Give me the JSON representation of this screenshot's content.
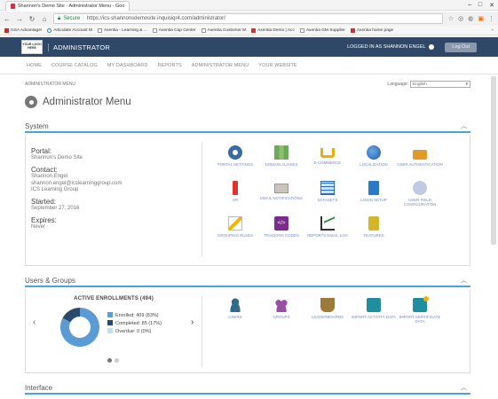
{
  "browser": {
    "window_title": "Shannon's Demo Site - Administrator Menu - Google Chrome",
    "secure_label": "Secure",
    "url": "https://ics-shannonsdemosite.inquisiqr4.com/administrator/",
    "bookmarks": [
      {
        "label": "GSA Advantage!",
        "icon": "red"
      },
      {
        "label": "Articulate Account M",
        "icon": "blue"
      },
      {
        "label": "Axentia - Learning & ...",
        "icon": "page"
      },
      {
        "label": "Axentia Cap Center",
        "icon": "page"
      },
      {
        "label": "Axentia Customer M",
        "icon": "page"
      },
      {
        "label": "Axentia Demo | Acc",
        "icon": "ax"
      },
      {
        "label": "Axentia GM Supplier",
        "icon": "page"
      },
      {
        "label": "Axentia home page",
        "icon": "ax"
      }
    ],
    "more": "»"
  },
  "header": {
    "logo_text": "YOUR LOGO HERE",
    "title": "ADMINISTRATOR",
    "logged_in": "LOGGED IN AS SHANNON ENGEL",
    "logout": "Log Out"
  },
  "menu": [
    "HOME",
    "COURSE CATALOG",
    "MY DASHBOARD",
    "REPORTS",
    "ADMINISTRATOR MENU",
    "YOUR WEBSITE"
  ],
  "page": {
    "breadcrumb": "ADMINISTRATOR MENU",
    "language_label": "Language:",
    "language_value": "English",
    "title": "Administrator Menu"
  },
  "system": {
    "heading": "System",
    "portal_label": "Portal:",
    "portal_value": "Shannon's Demo Site",
    "contact_label": "Contact:",
    "contact_name": "Shannon Engel",
    "contact_email": "shannon.engel@icslearninggroup.com",
    "contact_org": "ICS Learning Group",
    "started_label": "Started:",
    "started_value": "September 27, 2016",
    "expires_label": "Expires:",
    "expires_value": "Never",
    "tiles": [
      {
        "label": "PORTAL SETTINGS",
        "icon": "gear-icon",
        "cls": "ic-gear"
      },
      {
        "label": "DOMAIN ALIASES",
        "icon": "map-icon",
        "cls": "ic-map"
      },
      {
        "label": "E-COMMERCE",
        "icon": "cart-icon",
        "cls": "ic-cart"
      },
      {
        "label": "LOCALIZATION",
        "icon": "globe-icon",
        "cls": "ic-globe"
      },
      {
        "label": "USER AUTHENTICATION",
        "icon": "lock-icon",
        "cls": "ic-lock"
      },
      {
        "label": "API",
        "icon": "plug-icon",
        "cls": "ic-plug"
      },
      {
        "label": "EMAIL NOTIFICATIONS",
        "icon": "envelope-icon",
        "cls": "ic-env"
      },
      {
        "label": "DATASETS",
        "icon": "table-icon",
        "cls": "ic-table"
      },
      {
        "label": "LOGIN SETUP",
        "icon": "login-icon",
        "cls": "ic-login"
      },
      {
        "label": "USER FIELD CONFIGURATION",
        "icon": "user-gear-icon",
        "cls": "ic-ufield"
      },
      {
        "label": "GROUPING RULES",
        "icon": "bolt-icon",
        "cls": "ic-bolt"
      },
      {
        "label": "TRACKING CODES",
        "icon": "code-icon",
        "cls": "ic-code"
      },
      {
        "label": "REPORTS EMAIL LOG",
        "icon": "chart-icon",
        "cls": "ic-chart"
      },
      {
        "label": "FEATURES",
        "icon": "puzzle-icon",
        "cls": "ic-puzzle"
      }
    ]
  },
  "users_groups": {
    "heading": "Users & Groups",
    "enrollments_title": "ACTIVE ENROLLMENTS (494)",
    "legend": [
      {
        "label": "Enrolled: 409 (83%)",
        "value": 409,
        "color": "#5b9bd5"
      },
      {
        "label": "Completed: 85 (17%)",
        "value": 85,
        "color": "#2b4a6b"
      },
      {
        "label": "Overdue: 0 (0%)",
        "value": 0,
        "color": "#bfe0f2"
      }
    ],
    "tiles": [
      {
        "label": "USERS",
        "icon": "user-icon",
        "cls": "ic-users"
      },
      {
        "label": "GROUPS",
        "icon": "groups-icon",
        "cls": "ic-groups"
      },
      {
        "label": "LEADERBOARDS",
        "icon": "trophy-icon",
        "cls": "ic-trophy"
      },
      {
        "label": "IMPORT ACTIVITY DATA",
        "icon": "import-icon",
        "cls": "ic-import"
      },
      {
        "label": "IMPORT CERTIFICATE DATA",
        "icon": "certificate-icon",
        "cls": "ic-cert"
      }
    ]
  },
  "interface": {
    "heading": "Interface"
  }
}
